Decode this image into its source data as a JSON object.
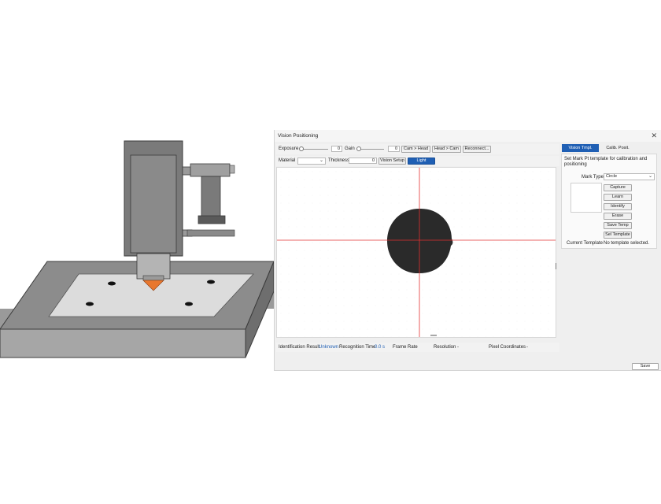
{
  "window": {
    "title": "Vision Positioning",
    "close_glyph": "✕"
  },
  "toolbar1": {
    "exposure_label": "Exposure",
    "exposure_value": "0",
    "exposure_level": 0,
    "gain_label": "Gain",
    "gain_value": "0",
    "gain_level": 0,
    "cam_head_label": "Cam > Head",
    "head_cam_label": "Head > Cam",
    "reconnect_label": "Reconnect..."
  },
  "toolbar2": {
    "material_label": "Material",
    "material_value": "",
    "thickness_label": "Thickness",
    "thickness_value": "0",
    "vision_setup_label": "Vision Setup",
    "light_label": "Light"
  },
  "status": {
    "identification_label": "Identification Result",
    "identification_value": "Unknown",
    "recognition_label": "Recognition Time",
    "recognition_value": "0.0 s",
    "frame_rate_label": "Frame Rate",
    "frame_rate_value": "-",
    "resolution_label": "Resolution",
    "resolution_value": "-",
    "pixel_coords_label": "Pixel Coordinates",
    "pixel_coords_value": "-"
  },
  "tabs": [
    {
      "label": "Vision Tmpl.",
      "active": true
    },
    {
      "label": "Calib. Posit.",
      "active": false
    }
  ],
  "template_panel": {
    "description": "Set Mark Pt template for calibration and positioning",
    "mark_type_label": "Mark Type",
    "mark_type_value": "Circle",
    "buttons": [
      "Capture",
      "Learn",
      "Identify",
      "Erase",
      "Save Temp",
      "Sel Template"
    ],
    "current_template_label": "Current Template",
    "current_template_value": "No template selected."
  },
  "footer": {
    "save_label": "Save"
  },
  "colors": {
    "accent": "#1f5fb4",
    "crosshair": "#e23232",
    "nozzle": "#e8772e",
    "machine": "#7a7a7a"
  },
  "icons": [
    "close-icon",
    "chevron-down-icon",
    "resize-grip-icon"
  ]
}
